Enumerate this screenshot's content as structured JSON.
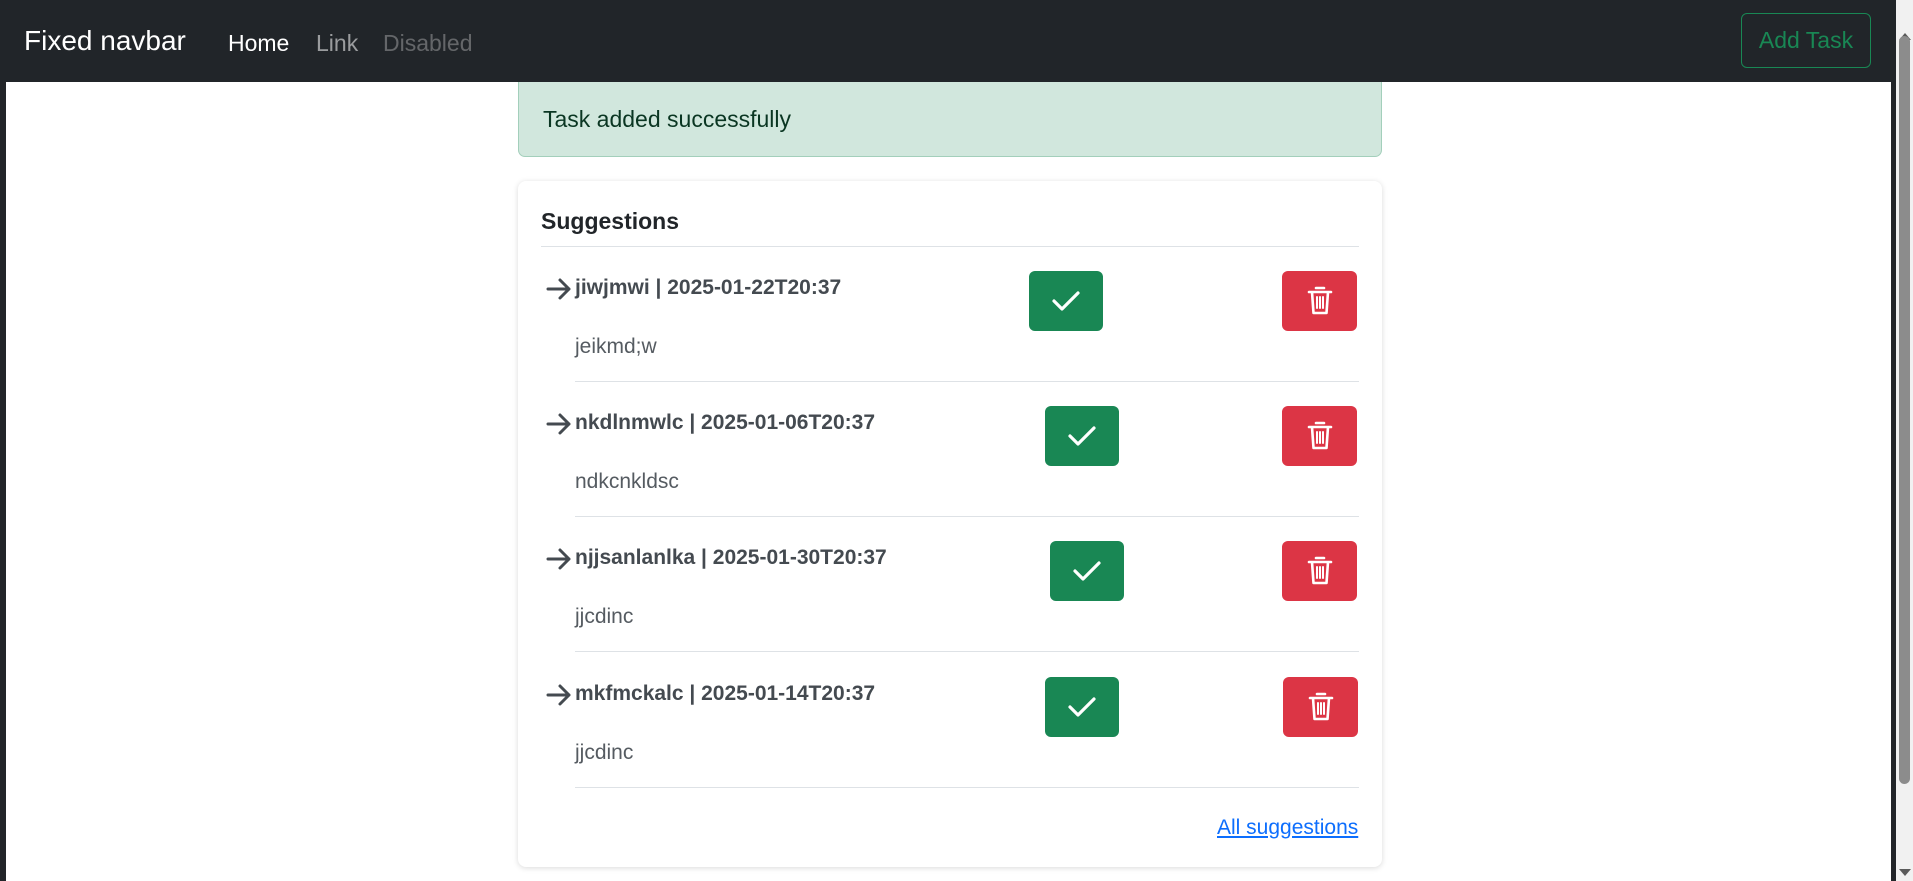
{
  "navbar": {
    "brand": "Fixed navbar",
    "links": [
      {
        "label": "Home"
      },
      {
        "label": "Link"
      },
      {
        "label": "Disabled"
      }
    ],
    "add_task_label": "Add Task"
  },
  "alert": {
    "message": "Task added successfully"
  },
  "suggestions": {
    "title": "Suggestions",
    "items": [
      {
        "title": "jiwjmwi | 2025-01-22T20:37",
        "description": "jeikmd;w"
      },
      {
        "title": "nkdlnmwlc | 2025-01-06T20:37",
        "description": "ndkcnkldsc"
      },
      {
        "title": "njjsanlanlka | 2025-01-30T20:37",
        "description": "jjcdinc"
      },
      {
        "title": "mkfmckalc | 2025-01-14T20:37",
        "description": "jjcdinc"
      }
    ],
    "all_link": "All suggestions"
  },
  "icons": {
    "item_marker": "arrow-right-icon",
    "accept": "check-icon",
    "delete": "trash-icon"
  },
  "colors": {
    "navbar_bg": "#212529",
    "success": "#198754",
    "danger": "#dc3545",
    "alert_bg": "#d1e7dd",
    "link": "#0d6efd"
  }
}
